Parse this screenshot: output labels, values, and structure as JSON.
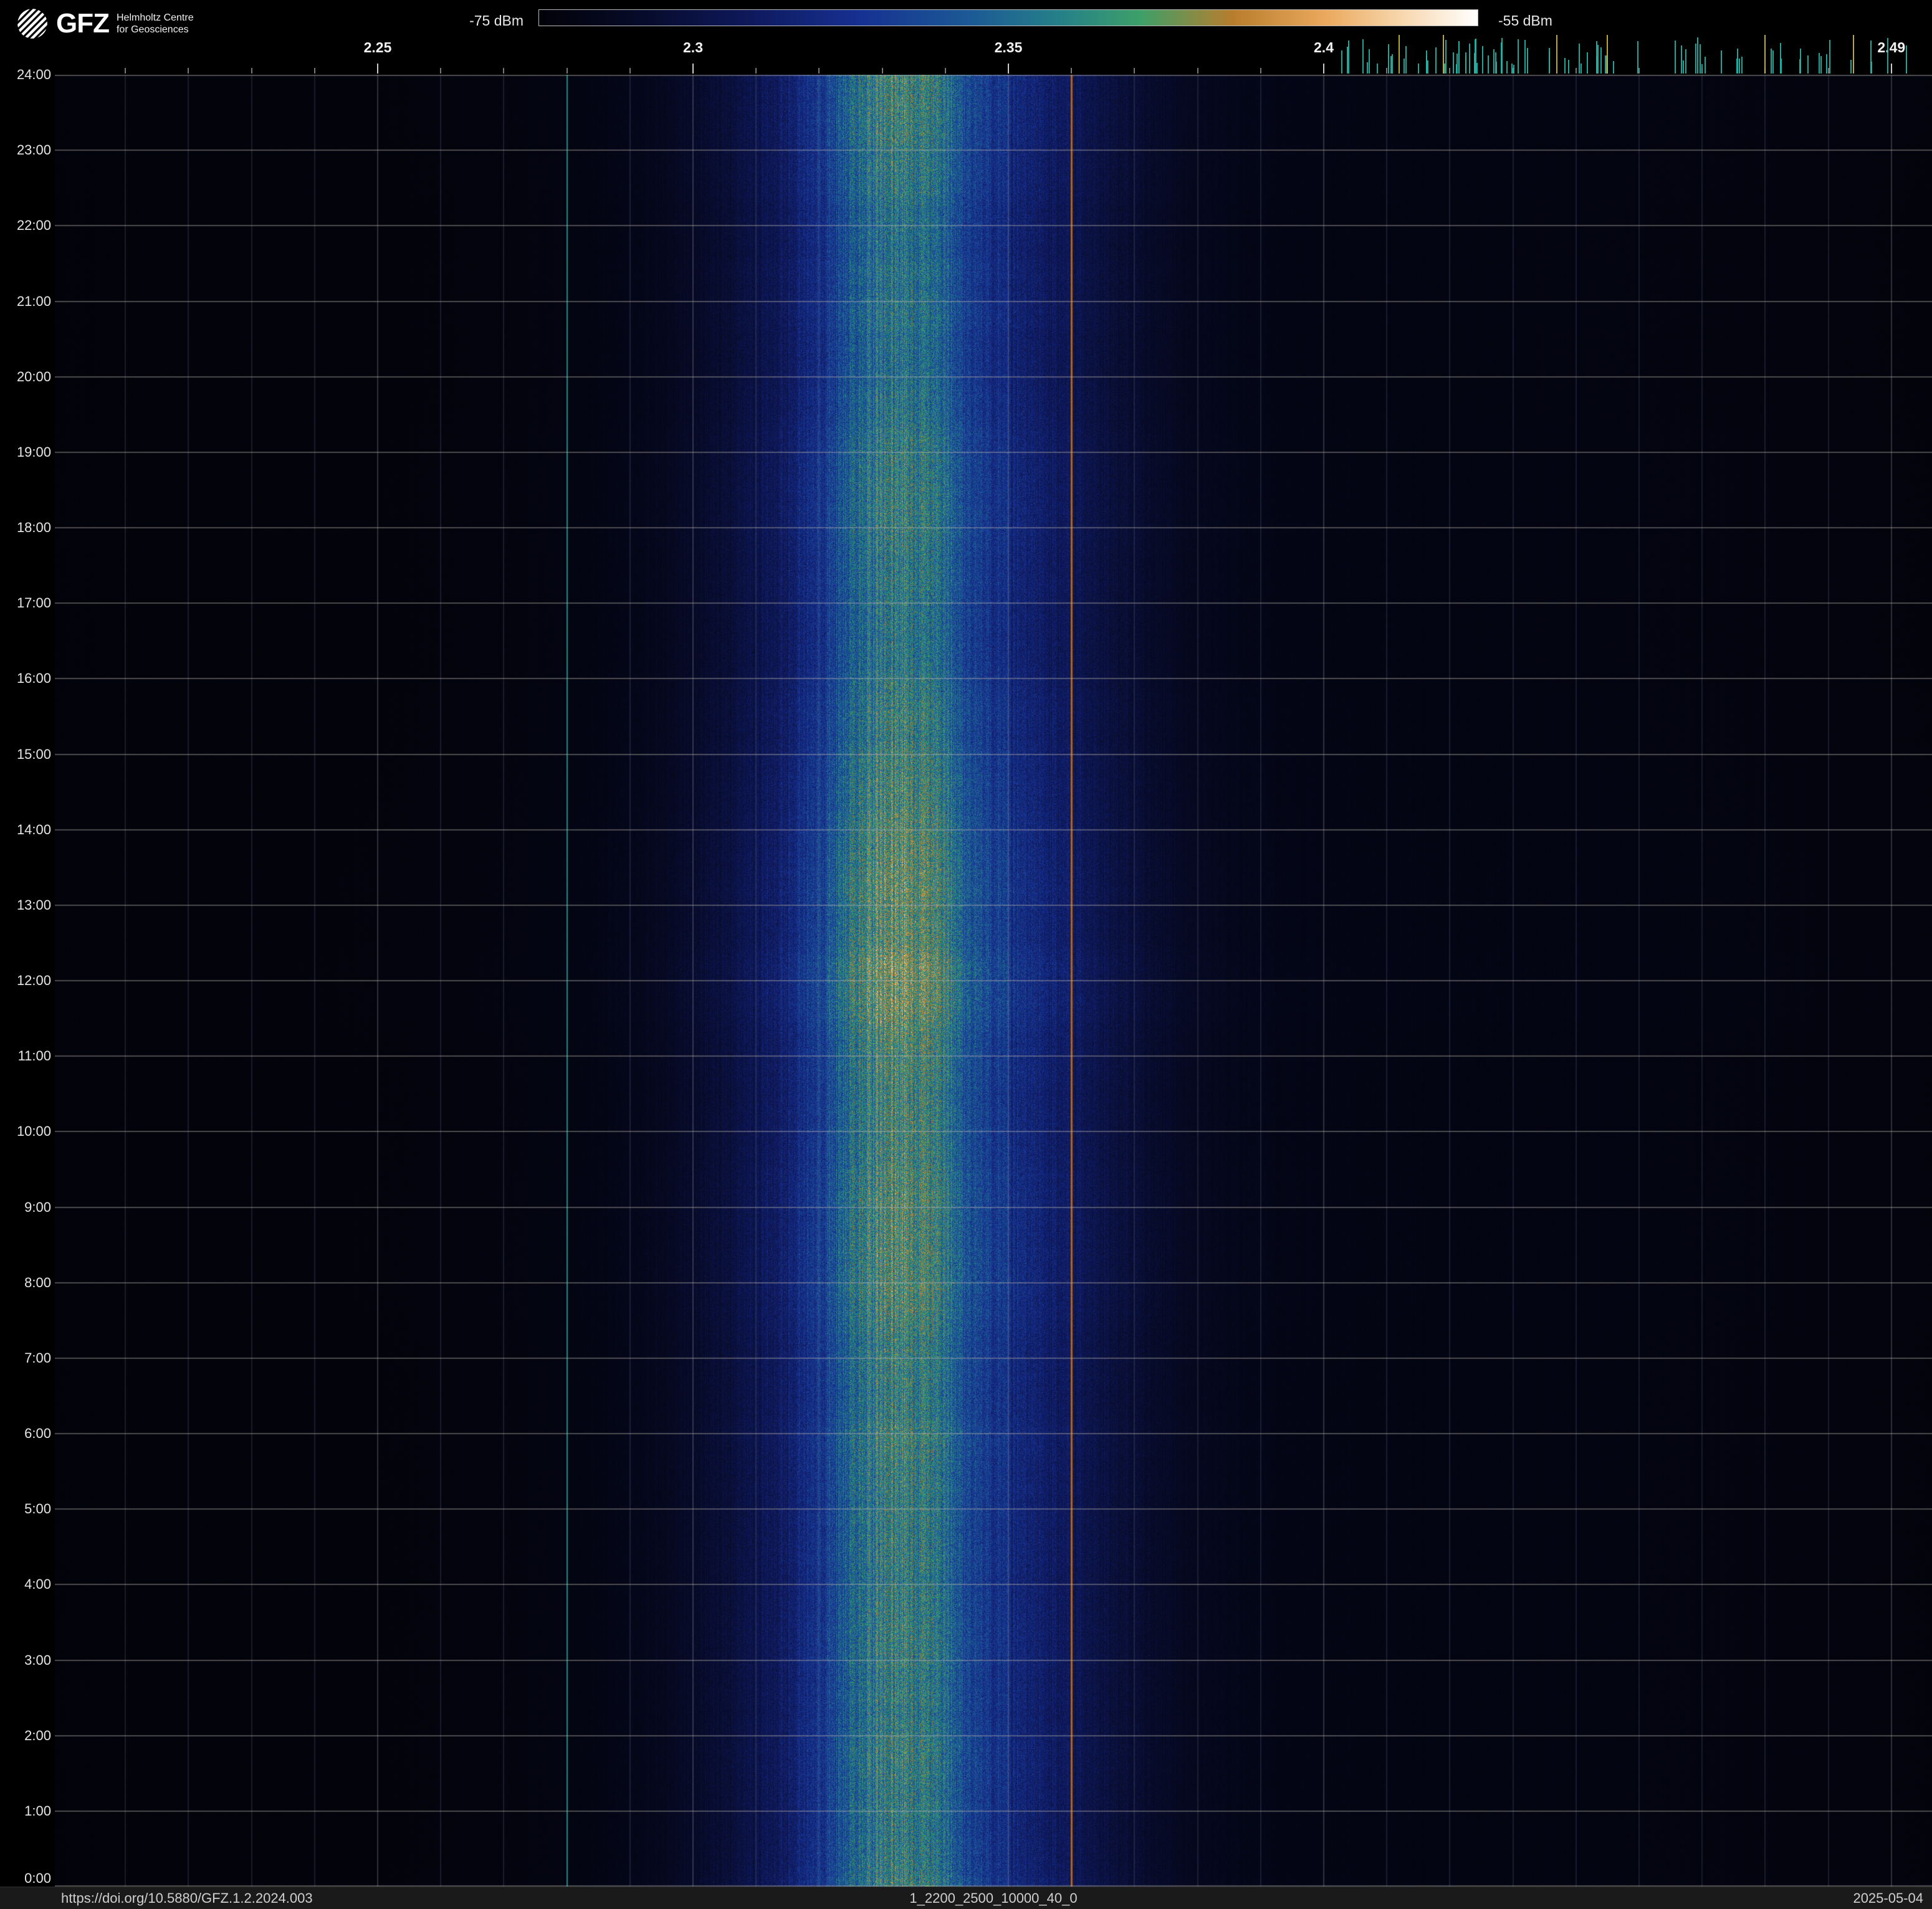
{
  "header": {
    "logo": {
      "acronym": "GFZ",
      "line1": "Helmholtz Centre",
      "line2": "for Geosciences"
    },
    "colorbar": {
      "min_label": "-75 dBm",
      "max_label": "-55 dBm"
    }
  },
  "footer": {
    "doi": "https://doi.org/10.5880/GFZ.1.2.2024.003",
    "dataset": "1_2200_2500_10000_40_0",
    "date": "2025-05-04"
  },
  "chart_data": {
    "type": "heatmap",
    "description": "24-hour radio-frequency spectrogram (waterfall), frequency in GHz on x-axis, time of day on y-axis, power in dBm as color",
    "x_ticks": [
      {
        "label": "2.25",
        "value": 2.25
      },
      {
        "label": "2.3",
        "value": 2.3
      },
      {
        "label": "2.35",
        "value": 2.35
      },
      {
        "label": "2.4",
        "value": 2.4
      },
      {
        "label": "2.49",
        "value": 2.49
      }
    ],
    "x_range_ghz": [
      2.199,
      2.496
    ],
    "y_ticks": [
      "24:00",
      "23:00",
      "22:00",
      "21:00",
      "20:00",
      "19:00",
      "18:00",
      "17:00",
      "16:00",
      "15:00",
      "14:00",
      "13:00",
      "12:00",
      "11:00",
      "10:00",
      "9:00",
      "8:00",
      "7:00",
      "6:00",
      "5:00",
      "4:00",
      "3:00",
      "2:00",
      "1:00",
      "0:00"
    ],
    "y_range_hours": [
      0,
      24
    ],
    "colorbar": {
      "min_dbm": -75,
      "max_dbm": -55,
      "stops": [
        {
          "t": 0.0,
          "color": "#020208"
        },
        {
          "t": 0.1,
          "color": "#060a26"
        },
        {
          "t": 0.22,
          "color": "#0e185a"
        },
        {
          "t": 0.34,
          "color": "#163091"
        },
        {
          "t": 0.46,
          "color": "#1c5a96"
        },
        {
          "t": 0.56,
          "color": "#268287"
        },
        {
          "t": 0.64,
          "color": "#3ca069"
        },
        {
          "t": 0.74,
          "color": "#b97d2d"
        },
        {
          "t": 0.84,
          "color": "#ebaa5f"
        },
        {
          "t": 0.92,
          "color": "#f7d7af"
        },
        {
          "t": 1.0,
          "color": "#ffffff"
        }
      ]
    },
    "bands": [
      {
        "name": "broad-blue-band",
        "center_ghz": 2.336,
        "sigma_ghz": 0.03,
        "amplitude": 0.55
      },
      {
        "name": "teal-core-band",
        "center_ghz": 2.3315,
        "sigma_ghz": 0.011,
        "amplitude": 0.4
      },
      {
        "name": "wide-faint-band",
        "center_ghz": 2.35,
        "sigma_ghz": 0.09,
        "amplitude": 0.05
      },
      {
        "name": "right-faint-band",
        "center_ghz": 2.445,
        "sigma_ghz": 0.07,
        "amplitude": 0.022
      }
    ],
    "noise_floor": 0.012,
    "speckle": {
      "base": 0.42,
      "range": 0.31,
      "row_walk": 0.012,
      "row_min": 0.88,
      "row_max": 1.14,
      "col_min": 0.84,
      "col_range": 0.32
    },
    "carrier_lines": [
      {
        "name": "teal-carrier",
        "freq_ghz": 2.28,
        "color": "rgba(22,175,155,0.75)",
        "width": 2
      },
      {
        "name": "orange-carrier",
        "freq_ghz": 2.36,
        "color": "rgba(195,110,30,0.85)",
        "width": 3
      }
    ],
    "grid": {
      "hour_step": 1,
      "freq_minor_step_ghz": 0.01,
      "hour_line_color": "rgba(185,180,170,0.40)",
      "minor_line_color": "rgba(105,115,155,0.22)",
      "major_line_color": "rgba(150,150,160,0.30)"
    },
    "channel_markers": {
      "teal": {
        "range_ghz": [
          2.401,
          2.4925
        ],
        "count": 90,
        "color": "#27b3a6"
      },
      "yellow_ghz": [
        2.412,
        2.419,
        2.437,
        2.445,
        2.47,
        2.484
      ],
      "yellow_color": "#c9b93e"
    }
  }
}
